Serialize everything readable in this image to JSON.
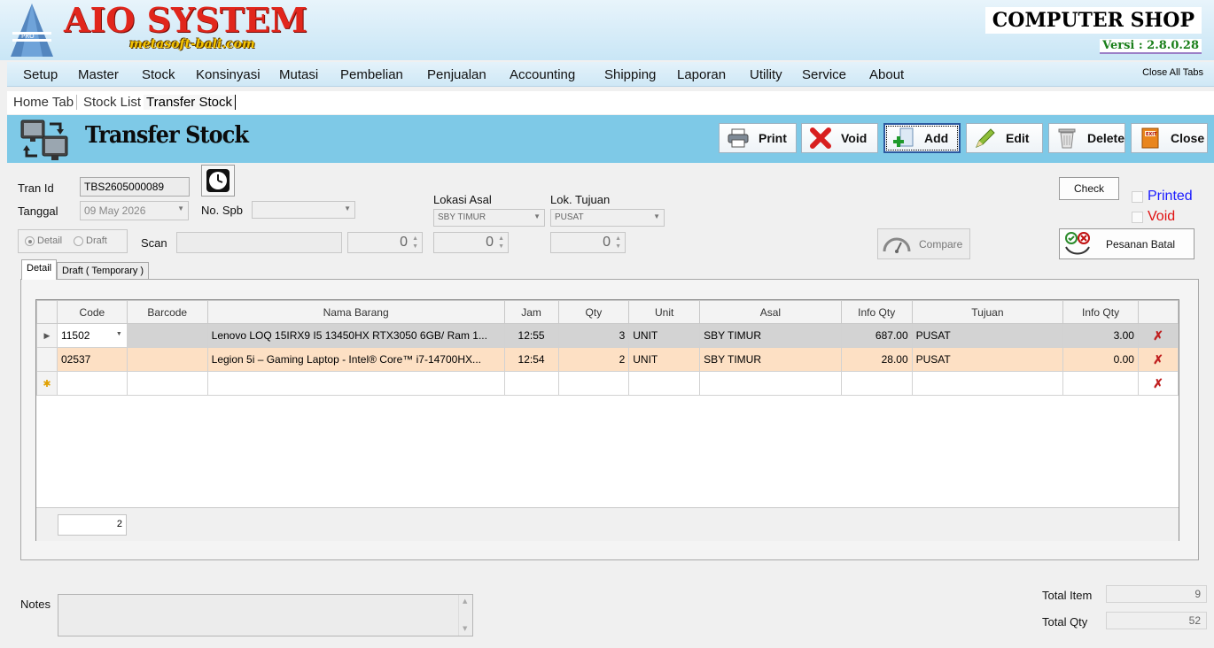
{
  "banner": {
    "logo_title": "AIO SYSTEM",
    "logo_sub": "metasoft-bali.com",
    "shop_title": "COMPUTER SHOP",
    "version": "Versi : 2.8.0.28"
  },
  "menu": {
    "items": [
      "Setup",
      "Master",
      "Stock",
      "Konsinyasi",
      "Mutasi",
      "Pembelian",
      "Penjualan",
      "Accounting",
      "Shipping",
      "Laporan",
      "Utility",
      "Service",
      "About"
    ],
    "close_all": "Close All Tabs"
  },
  "tabs": [
    "Home Tab",
    "Stock List",
    "Transfer Stock"
  ],
  "form": {
    "title": "Transfer Stock",
    "toolbar": {
      "print": "Print",
      "void": "Void",
      "add": "Add",
      "edit": "Edit",
      "delete": "Delete",
      "close": "Close"
    },
    "tran_id_label": "Tran Id",
    "tran_id": "TBS2605000089",
    "tanggal_label": "Tanggal",
    "tanggal": "09 May 2026",
    "no_spb_label": "No. Spb",
    "no_spb": "",
    "lokasi_asal_label": "Lokasi Asal",
    "lokasi_asal": "SBY TIMUR",
    "lok_tujuan_label": "Lok. Tujuan",
    "lok_tujuan": "PUSAT",
    "radio_detail": "Detail",
    "radio_draft": "Draft",
    "scan_label": "Scan",
    "scan_value": "",
    "spin1": "0",
    "spin2": "0",
    "spin3": "0",
    "check_btn": "Check",
    "printed_label": "Printed",
    "void_label": "Void",
    "compare_btn": "Compare",
    "pesanan_batal_btn": "Pesanan Batal",
    "colors": {
      "printed": "#1a1aff",
      "void": "#e01010"
    }
  },
  "inner_tabs": [
    "Detail",
    "Draft ( Temporary )"
  ],
  "grid": {
    "columns": [
      "Code",
      "Barcode",
      "Nama Barang",
      "Jam",
      "Qty",
      "Unit",
      "Asal",
      "Info Qty",
      "Tujuan",
      "Info Qty"
    ],
    "rows": [
      {
        "code": "11502",
        "barcode": "",
        "nama": "Lenovo LOQ 15IRX9 I5 13450HX RTX3050 6GB/ Ram 1...",
        "jam": "12:55",
        "qty": "3",
        "unit": "UNIT",
        "asal": "SBY TIMUR",
        "info_qty_asal": "687.00",
        "tujuan": "PUSAT",
        "info_qty_tujuan": "3.00"
      },
      {
        "code": "02537",
        "barcode": "",
        "nama": "Legion 5i – Gaming Laptop - Intel® Core™ i7-14700HX...",
        "jam": "12:54",
        "qty": "2",
        "unit": "UNIT",
        "asal": "SBY TIMUR",
        "info_qty_asal": "28.00",
        "tujuan": "PUSAT",
        "info_qty_tujuan": "0.00"
      }
    ],
    "footer_count": "2"
  },
  "bottom": {
    "notes_label": "Notes",
    "notes_value": "",
    "total_item_label": "Total Item",
    "total_item": "9",
    "total_qty_label": "Total Qty",
    "total_qty": "52"
  }
}
